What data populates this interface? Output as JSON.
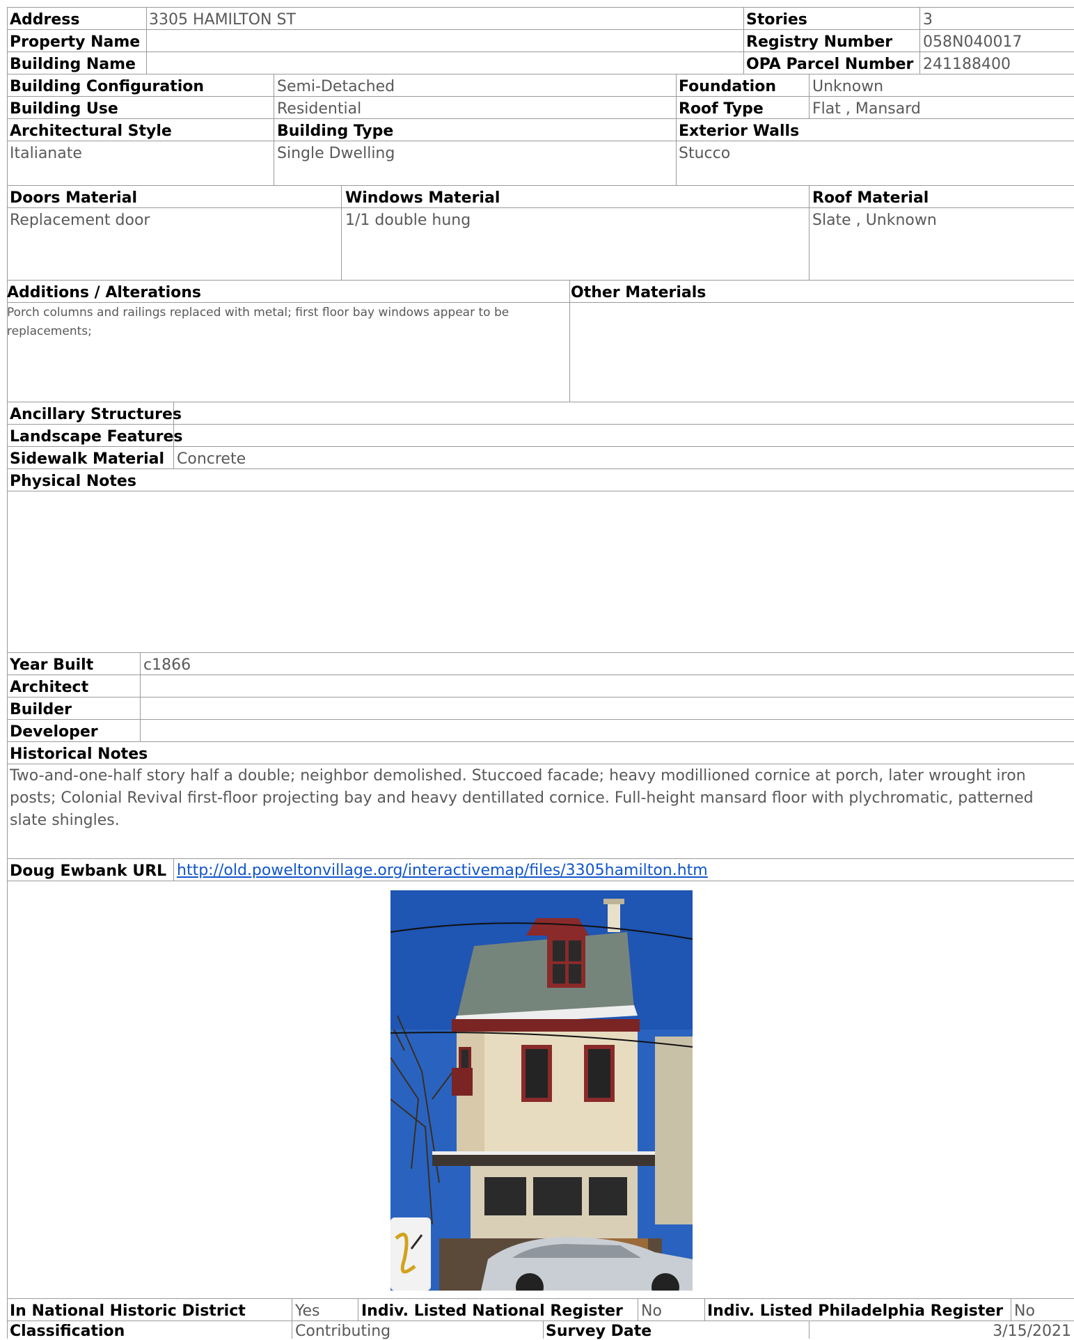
{
  "address": {
    "label": "Address",
    "value": "3305 HAMILTON ST"
  },
  "stories": {
    "label": "Stories",
    "value": "3"
  },
  "property_name": {
    "label": "Property Name",
    "value": ""
  },
  "registry_number": {
    "label": "Registry Number",
    "value": "058N040017"
  },
  "building_name": {
    "label": "Building Name",
    "value": ""
  },
  "opa_parcel": {
    "label": "OPA Parcel Number",
    "value": "241188400"
  },
  "building_configuration": {
    "label": "Building Configuration",
    "value": "Semi-Detached"
  },
  "foundation": {
    "label": "Foundation",
    "value": "Unknown"
  },
  "building_use": {
    "label": "Building Use",
    "value": "Residential"
  },
  "roof_type": {
    "label": "Roof Type",
    "value": "Flat , Mansard"
  },
  "architectural_style": {
    "label": "Architectural Style",
    "value": "Italianate"
  },
  "building_type": {
    "label": "Building Type",
    "value": "Single Dwelling"
  },
  "exterior_walls": {
    "label": "Exterior Walls",
    "value": "Stucco"
  },
  "doors_material": {
    "label": "Doors Material",
    "value": "Replacement door"
  },
  "windows_material": {
    "label": "Windows Material",
    "value": "1/1 double hung"
  },
  "roof_material": {
    "label": "Roof Material",
    "value": "Slate , Unknown"
  },
  "additions": {
    "label": "Additions / Alterations",
    "value": "Porch columns and railings replaced with metal; first floor bay windows appear to be replacements;"
  },
  "other_materials": {
    "label": "Other Materials",
    "value": ""
  },
  "ancillary_structures": {
    "label": "Ancillary Structures",
    "value": ""
  },
  "landscape_features": {
    "label": "Landscape Features",
    "value": ""
  },
  "sidewalk_material": {
    "label": "Sidewalk Material",
    "value": "Concrete"
  },
  "physical_notes": {
    "label": "Physical Notes",
    "value": ""
  },
  "year_built": {
    "label": "Year Built",
    "value": "c1866"
  },
  "architect": {
    "label": "Architect",
    "value": ""
  },
  "builder": {
    "label": "Builder",
    "value": ""
  },
  "developer": {
    "label": "Developer",
    "value": ""
  },
  "historical_notes": {
    "label": "Historical Notes",
    "value": "Two-and-one-half story half a double; neighbor demolished. Stuccoed facade; heavy modillioned cornice at porch, later wrought iron posts; Colonial Revival first-floor projecting bay and heavy dentillated cornice. Full-height mansard floor with plychromatic, patterned slate shingles."
  },
  "doug_ewbank_url": {
    "label": "Doug Ewbank URL",
    "value": "http://old.poweltonvillage.org/interactivemap/files/3305hamilton.htm"
  },
  "national_district": {
    "label": "In National Historic District",
    "value": "Yes"
  },
  "indiv_national": {
    "label": "Indiv. Listed National Register",
    "value": "No"
  },
  "indiv_philadelphia": {
    "label": "Indiv. Listed Philadelphia Register",
    "value": "No"
  },
  "classification": {
    "label": "Classification",
    "value": "Contributing"
  },
  "survey_date": {
    "label": "Survey Date",
    "value": "3/15/2021"
  }
}
